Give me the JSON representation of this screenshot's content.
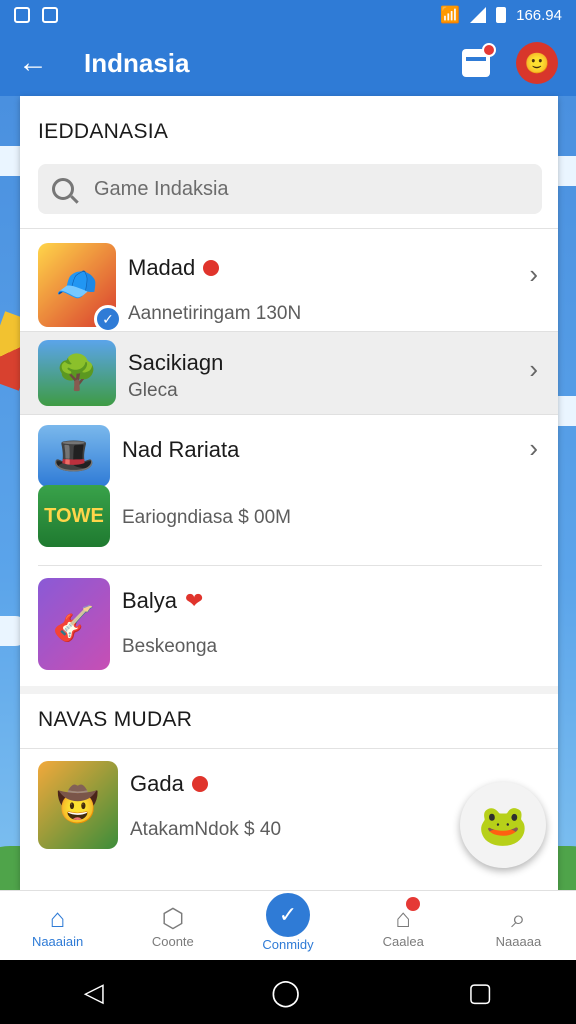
{
  "status_bar": {
    "time": "166.94"
  },
  "app_bar": {
    "title": "Indnasia"
  },
  "section_one": {
    "title": "IEDDANASIA"
  },
  "search": {
    "placeholder": "Game Indaksia"
  },
  "games": [
    {
      "title": "Madad",
      "subtitle": "Aannetiringam 130N",
      "icon": "🧢",
      "badge": "red-dot",
      "verified": true
    },
    {
      "title": "Sacikiagn",
      "subtitle": "Gleca",
      "icon": "🌳"
    },
    {
      "title": "Nad Rariata",
      "subtitle": "",
      "icon": "🎩"
    },
    {
      "title": "",
      "subtitle": "Eariogndiasa $ 00M",
      "icon": "TOWE"
    },
    {
      "title": "Balya",
      "subtitle": "Beskeonga",
      "icon": "🎸"
    }
  ],
  "section_two": {
    "title": "NAVAS MUDAR"
  },
  "section_two_items": [
    {
      "title": "Gada",
      "subtitle": "AtakamNdok $ 40",
      "icon": "🤠"
    }
  ],
  "bottom_nav": [
    {
      "label": "Naaaiain",
      "icon": "⌂"
    },
    {
      "label": "Coonte",
      "icon": "⬡"
    },
    {
      "label": "Conmidy",
      "icon": "✓"
    },
    {
      "label": "Caalea",
      "icon": "⌂"
    },
    {
      "label": "Naaaaa",
      "icon": "⌕"
    }
  ],
  "system_nav": {
    "back": "◁",
    "home": "◯",
    "recents": "▢"
  },
  "colors": {
    "primary": "#2f7bd6",
    "accent_red": "#e0342c"
  }
}
